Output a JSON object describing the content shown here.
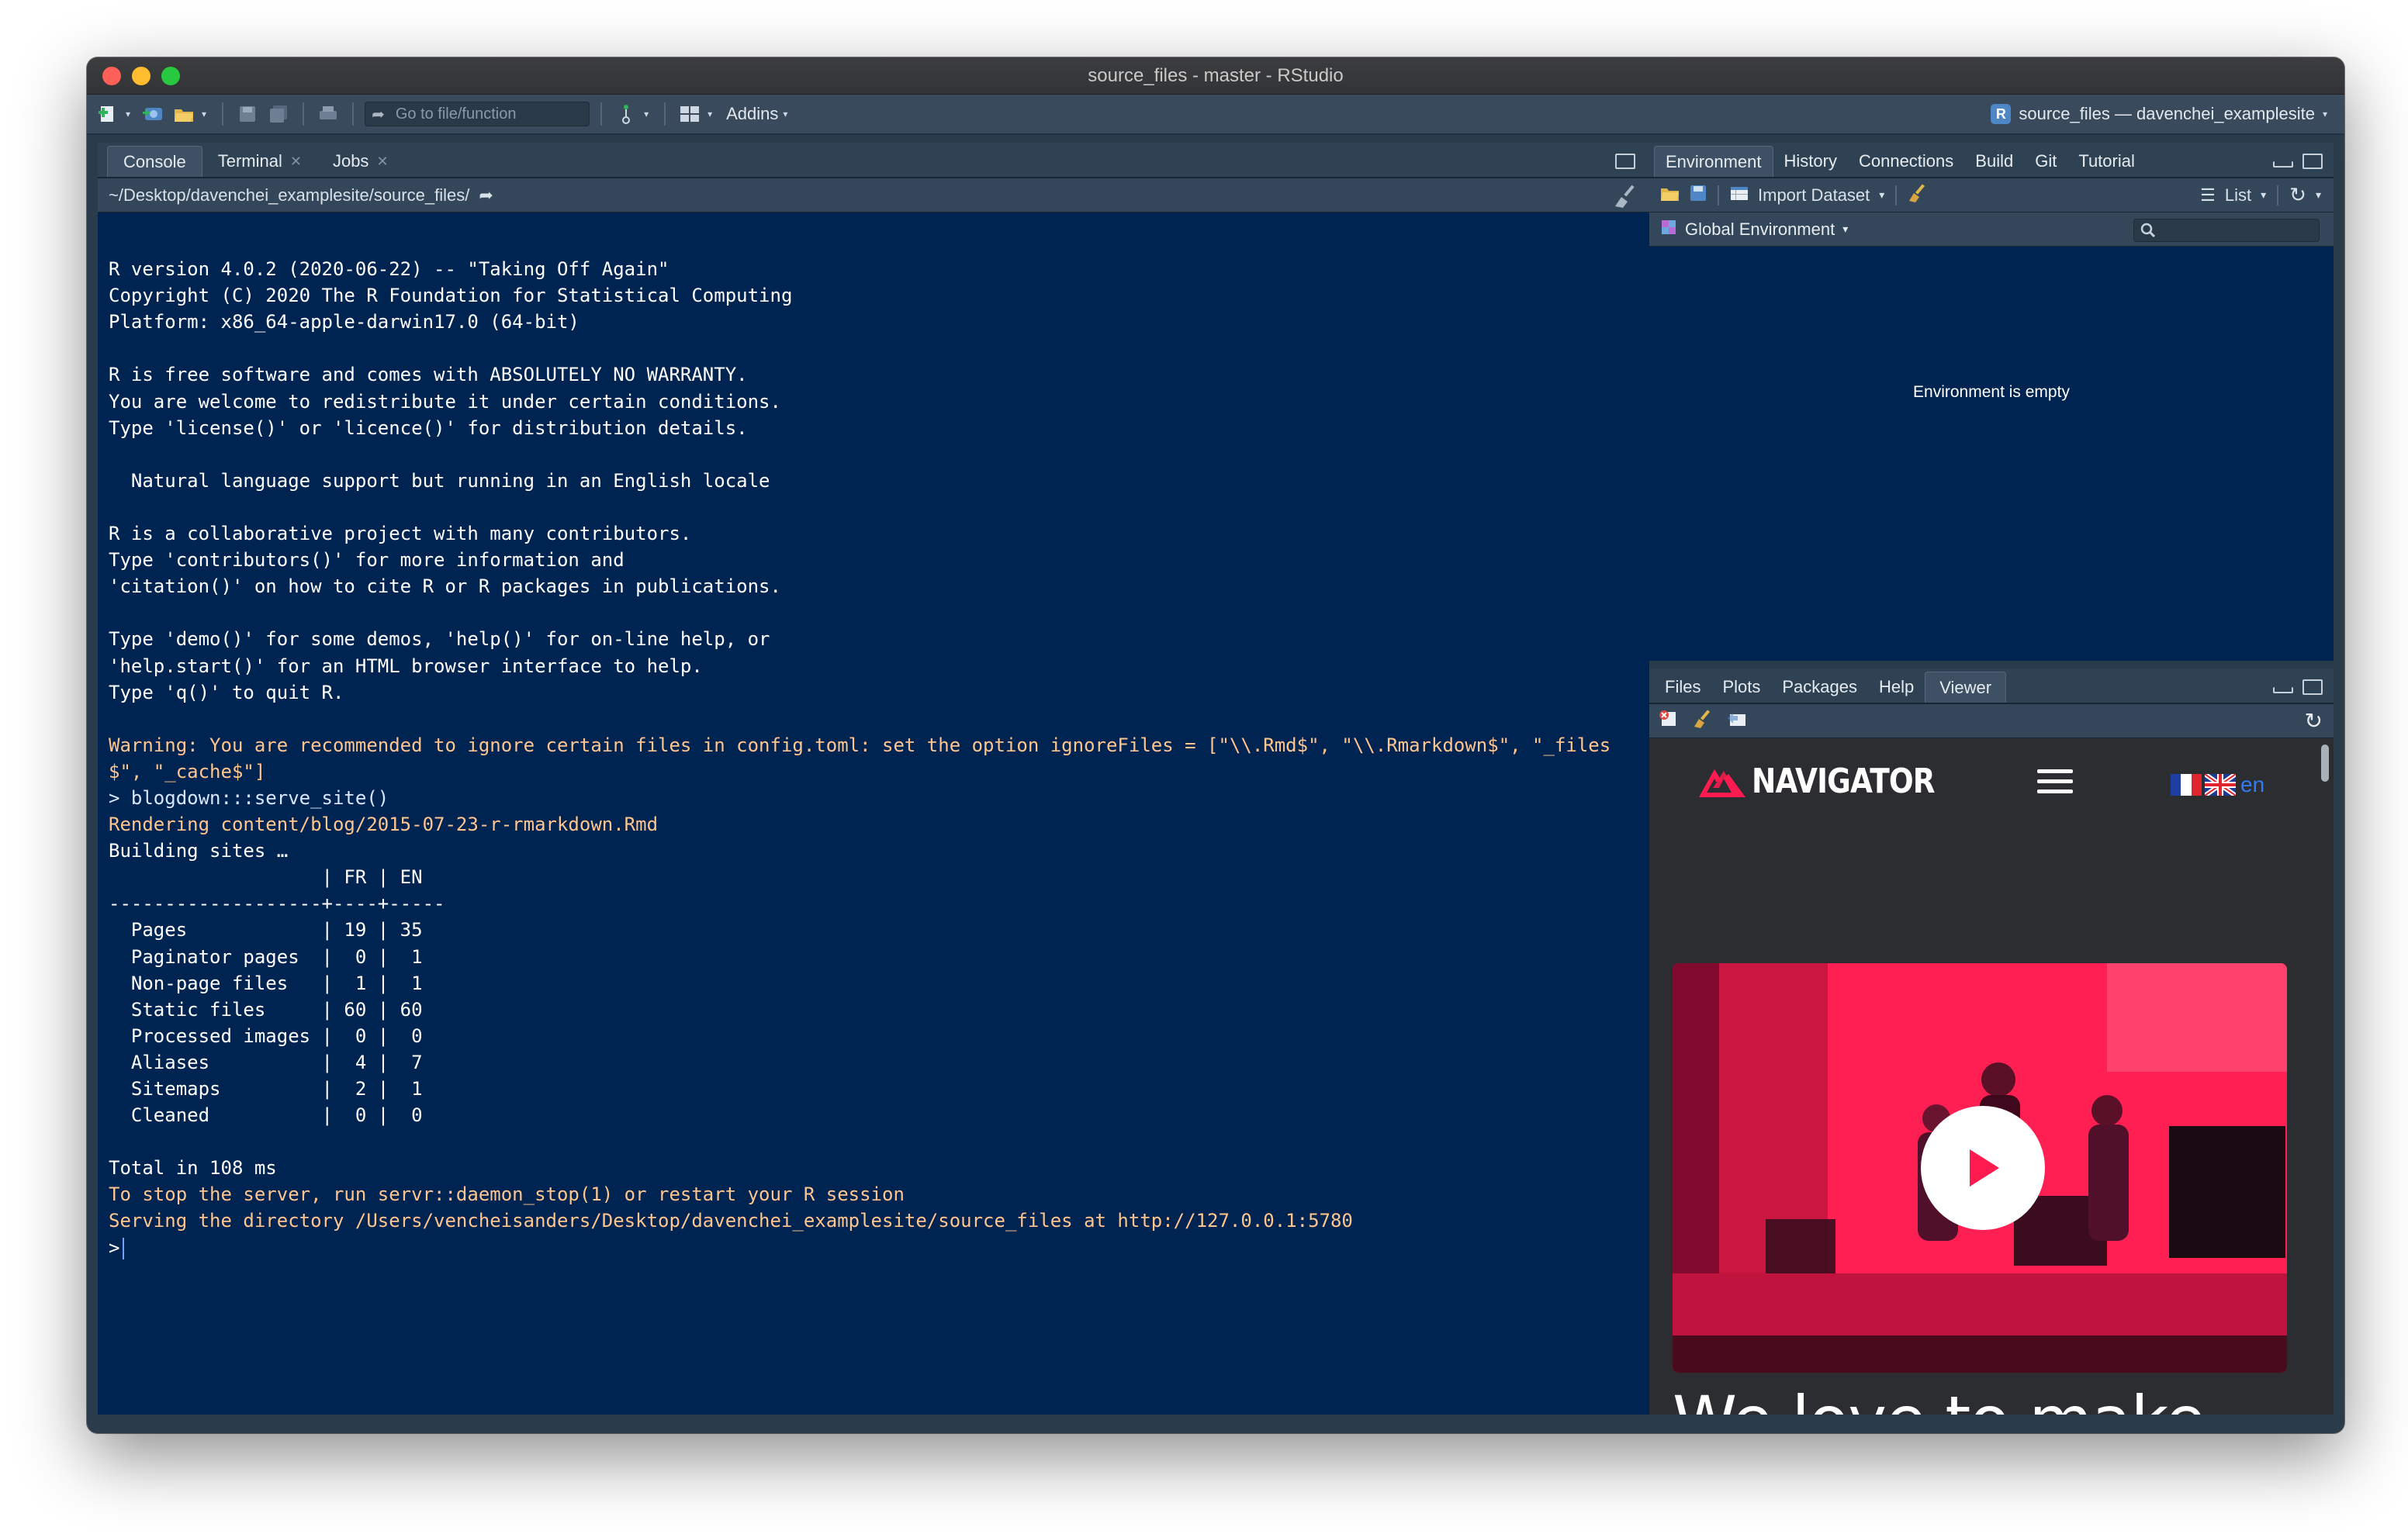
{
  "window": {
    "title": "source_files - master - RStudio"
  },
  "toolbar": {
    "goto_placeholder": "Go to file/function",
    "addins_label": "Addins",
    "project_label": "source_files — davenchei_examplesite"
  },
  "console_pane": {
    "tabs": [
      {
        "label": "Console",
        "closable": false
      },
      {
        "label": "Terminal",
        "closable": true
      },
      {
        "label": "Jobs",
        "closable": true
      }
    ],
    "path": "~/Desktop/davenchei_examplesite/source_files/",
    "lines": [
      {
        "text": "",
        "kind": "out"
      },
      {
        "text": "R version 4.0.2 (2020-06-22) -- \"Taking Off Again\"",
        "kind": "out"
      },
      {
        "text": "Copyright (C) 2020 The R Foundation for Statistical Computing",
        "kind": "out"
      },
      {
        "text": "Platform: x86_64-apple-darwin17.0 (64-bit)",
        "kind": "out"
      },
      {
        "text": "",
        "kind": "out"
      },
      {
        "text": "R is free software and comes with ABSOLUTELY NO WARRANTY.",
        "kind": "out"
      },
      {
        "text": "You are welcome to redistribute it under certain conditions.",
        "kind": "out"
      },
      {
        "text": "Type 'license()' or 'licence()' for distribution details.",
        "kind": "out"
      },
      {
        "text": "",
        "kind": "out"
      },
      {
        "text": "  Natural language support but running in an English locale",
        "kind": "out"
      },
      {
        "text": "",
        "kind": "out"
      },
      {
        "text": "R is a collaborative project with many contributors.",
        "kind": "out"
      },
      {
        "text": "Type 'contributors()' for more information and",
        "kind": "out"
      },
      {
        "text": "'citation()' on how to cite R or R packages in publications.",
        "kind": "out"
      },
      {
        "text": "",
        "kind": "out"
      },
      {
        "text": "Type 'demo()' for some demos, 'help()' for on-line help, or",
        "kind": "out"
      },
      {
        "text": "'help.start()' for an HTML browser interface to help.",
        "kind": "out"
      },
      {
        "text": "Type 'q()' to quit R.",
        "kind": "out"
      },
      {
        "text": "",
        "kind": "out"
      },
      {
        "text": "Warning: You are recommended to ignore certain files in config.toml: set the option ignoreFiles = [\"\\\\.Rmd$\", \"\\\\.Rmarkdown$\", \"_files",
        "kind": "warn"
      },
      {
        "text": "$\", \"_cache$\"]",
        "kind": "warn"
      },
      {
        "text": "> blogdown:::serve_site()",
        "kind": "cmd"
      },
      {
        "text": "Rendering content/blog/2015-07-23-r-rmarkdown.Rmd",
        "kind": "warn"
      },
      {
        "text": "Building sites …",
        "kind": "out"
      },
      {
        "text": "                   | FR | EN",
        "kind": "out"
      },
      {
        "text": "-------------------+----+-----",
        "kind": "out"
      },
      {
        "text": "  Pages            | 19 | 35",
        "kind": "out"
      },
      {
        "text": "  Paginator pages  |  0 |  1",
        "kind": "out"
      },
      {
        "text": "  Non-page files   |  1 |  1",
        "kind": "out"
      },
      {
        "text": "  Static files     | 60 | 60",
        "kind": "out"
      },
      {
        "text": "  Processed images |  0 |  0",
        "kind": "out"
      },
      {
        "text": "  Aliases          |  4 |  7",
        "kind": "out"
      },
      {
        "text": "  Sitemaps         |  2 |  1",
        "kind": "out"
      },
      {
        "text": "  Cleaned          |  0 |  0",
        "kind": "out"
      },
      {
        "text": "",
        "kind": "out"
      },
      {
        "text": "Total in 108 ms",
        "kind": "out"
      },
      {
        "text": "To stop the server, run servr::daemon_stop(1) or restart your R session",
        "kind": "warn"
      },
      {
        "text": "Serving the directory /Users/vencheisanders/Desktop/davenchei_examplesite/source_files at http://127.0.0.1:5780",
        "kind": "warn"
      }
    ],
    "prompt": ">"
  },
  "env_pane": {
    "tabs": [
      "Environment",
      "History",
      "Connections",
      "Build",
      "Git",
      "Tutorial"
    ],
    "import_label": "Import Dataset",
    "view_label": "List",
    "scope_label": "Global Environment",
    "empty_message": "Environment is empty"
  },
  "viewer_pane": {
    "tabs": [
      "Files",
      "Plots",
      "Packages",
      "Help",
      "Viewer"
    ],
    "active_tab": "Viewer",
    "site": {
      "logo_text": "NAVIGATOR",
      "lang_label": "en",
      "tagline": "We love to make",
      "brand_color": "#ff1a4f"
    }
  },
  "colors": {
    "console_bg": "#002451",
    "warning_text": "#ffc58f",
    "chrome": "#2f4254"
  }
}
